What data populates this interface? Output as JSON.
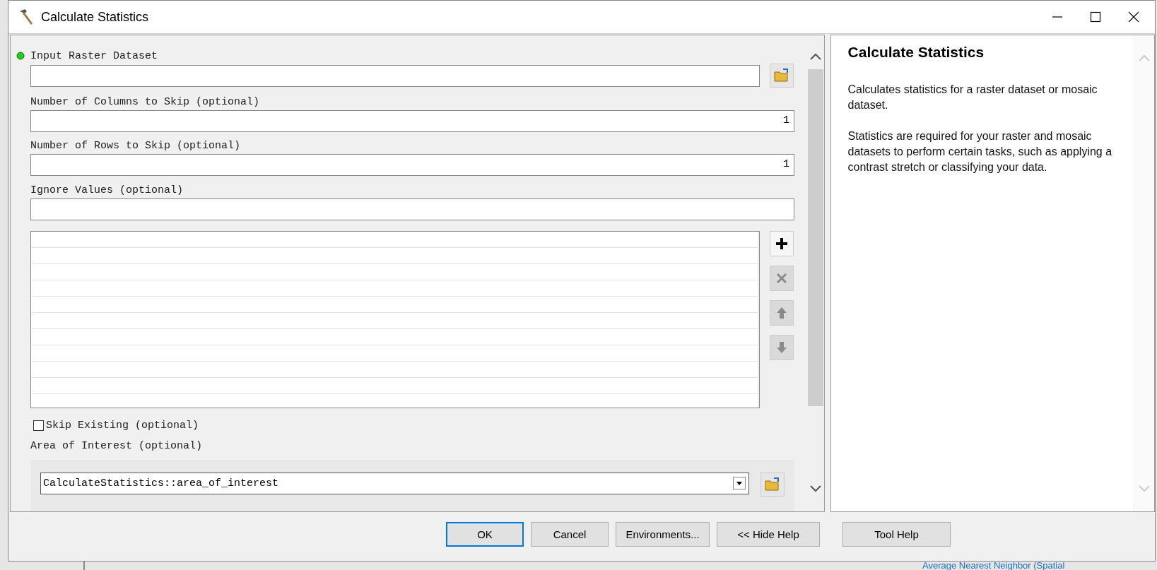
{
  "window": {
    "title": "Calculate Statistics"
  },
  "parameters": [
    {
      "kind": "browse",
      "label": "Input Raster Dataset",
      "required": true
    },
    {
      "kind": "number",
      "label": "Number of Columns to Skip (optional)",
      "required": false,
      "value": "1"
    },
    {
      "kind": "number",
      "label": "Number of Rows to Skip (optional)",
      "required": false,
      "value": "1"
    },
    {
      "kind": "list",
      "label": "Ignore Values (optional)",
      "required": false
    },
    {
      "kind": "checkbox",
      "label": "Skip Existing (optional)",
      "required": false,
      "checked": false
    },
    {
      "kind": "combo",
      "label": "Area of Interest (optional)",
      "required": false,
      "value": "CalculateStatistics::area_of_interest"
    }
  ],
  "list_buttons": [
    {
      "kind": "add",
      "disabled": false
    },
    {
      "kind": "remove",
      "disabled": true
    },
    {
      "kind": "up",
      "disabled": true
    },
    {
      "kind": "down",
      "disabled": true
    }
  ],
  "help": {
    "title": "Calculate Statistics",
    "paragraphs": [
      "Calculates statistics for a raster dataset or mosaic dataset.",
      "Statistics are required for your raster and mosaic datasets to perform certain tasks, such as applying a contrast stretch or classifying your data."
    ]
  },
  "buttons": [
    {
      "label": "OK",
      "focused": true
    },
    {
      "label": "Cancel",
      "focused": false
    },
    {
      "label": "Environments...",
      "focused": false
    },
    {
      "label": "<< Hide Help",
      "focused": false
    },
    {
      "label": "Tool Help",
      "focused": false
    }
  ],
  "background": {
    "text": "Average Nearest Neighbor (Spatial"
  }
}
